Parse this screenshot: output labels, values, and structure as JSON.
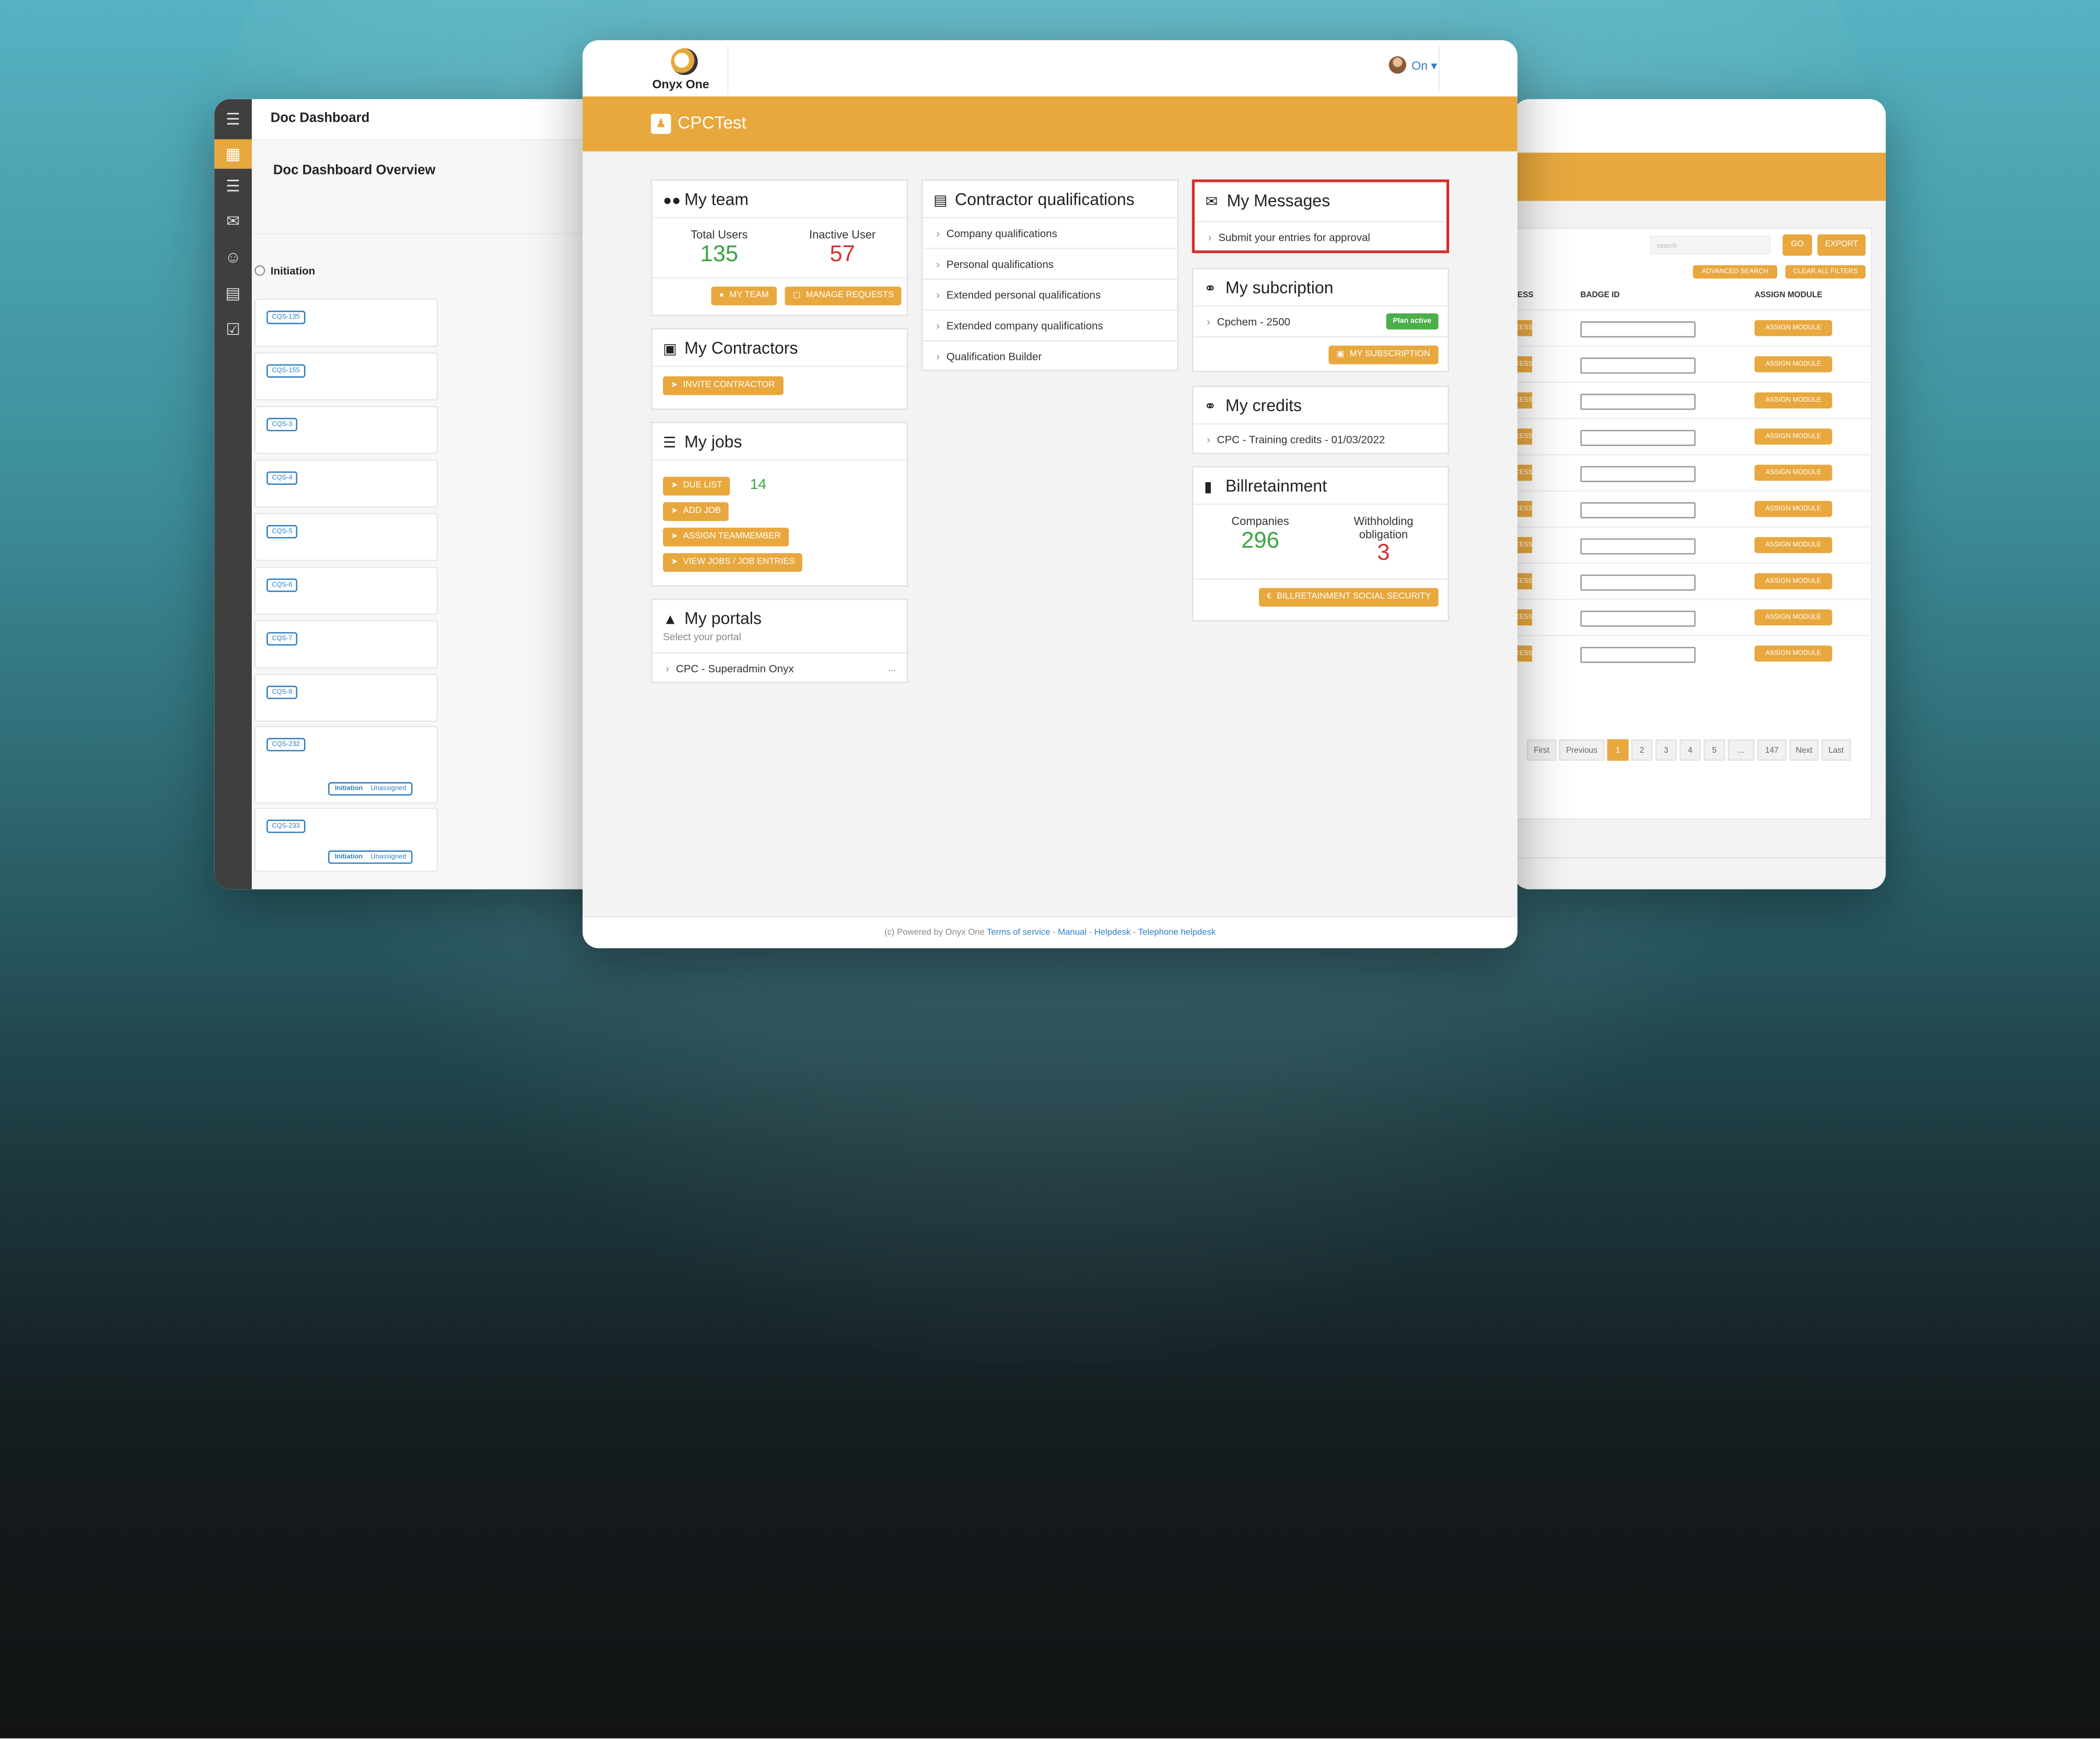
{
  "background_window_left": {
    "title": "Doc Dashboard",
    "overview": "Doc Dashboard Overview",
    "stage": "Initiation",
    "cards": [
      {
        "tag": "CQS-135"
      },
      {
        "tag": "CQS-155"
      },
      {
        "tag": "CQS-3"
      },
      {
        "tag": "CQS-4"
      },
      {
        "tag": "CQS-5"
      },
      {
        "tag": "CQS-6"
      },
      {
        "tag": "CQS-7"
      },
      {
        "tag": "CQS-8"
      },
      {
        "tag": "CQS-232",
        "pill_stage": "Initiation",
        "pill_status": "Unassigned"
      },
      {
        "tag": "CQS-233",
        "pill_stage": "Initiation",
        "pill_status": "Unassigned"
      }
    ],
    "rail_icons": [
      "menu-icon",
      "dashboard-icon",
      "list-icon",
      "inbox-icon",
      "user-icon",
      "building-icon",
      "checklist-icon"
    ]
  },
  "background_window_right": {
    "search_placeholder": "search",
    "go_label": "GO",
    "export_label": "EXPORT",
    "advanced_search_label": "ADVANCED SEARCH",
    "clear_filters_label": "CLEAR ALL FILTERS",
    "col_access": "ESS",
    "col_badge": "BADGE ID",
    "col_assign": "ASSIGN MODULE",
    "row_access_label": "ACCESS",
    "row_assign_label": "ASSIGN MODULE",
    "row_count": 10,
    "pager": [
      "First",
      "Previous",
      "1",
      "2",
      "3",
      "4",
      "5",
      "...",
      "147",
      "Next",
      "Last"
    ],
    "pager_current": "1"
  },
  "header": {
    "logo_text": "Onyx One",
    "user_label": "On ▾",
    "portal_title": "CPCTest"
  },
  "my_team": {
    "title": "My team",
    "total_label": "Total Users",
    "total_value": "135",
    "inactive_label": "Inactive User",
    "inactive_value": "57",
    "btn_team": "MY TEAM",
    "btn_requests": "MANAGE REQUESTS"
  },
  "my_contractors": {
    "title": "My Contractors",
    "btn_invite": "INVITE CONTRACTOR"
  },
  "my_jobs": {
    "title": "My jobs",
    "btn_due": "DUE LIST",
    "due_count": "14",
    "btn_add": "ADD JOB",
    "btn_assign": "ASSIGN TEAMMEMBER",
    "btn_view": "VIEW JOBS / JOB ENTRIES"
  },
  "my_portals": {
    "title": "My portals",
    "subtitle": "Select your portal",
    "item": "CPC - Superadmin Onyx",
    "item_more": "..."
  },
  "contractor_qualifications": {
    "title": "Contractor qualifications",
    "items": [
      "Company qualifications",
      "Personal qualifications",
      "Extended personal qualifications",
      "Extended company qualifications",
      "Qualification Builder"
    ]
  },
  "my_messages": {
    "title": "My Messages",
    "item": "Submit your entries for approval",
    "highlight_color": "#d62b2b"
  },
  "my_subscription": {
    "title": "My subcription",
    "item": "Cpchem - 2500",
    "status": "Plan active",
    "btn": "MY SUBSCRIPTION"
  },
  "my_credits": {
    "title": "My credits",
    "item": "CPC  -  Training credits  -  01/03/2022"
  },
  "billretainment": {
    "title": "Billretainment",
    "companies_label": "Companies",
    "companies_value": "296",
    "withholding_label": "Withholding obligation",
    "withholding_value": "3",
    "btn": "BILLRETAINMENT SOCIAL SECURITY"
  },
  "footer": {
    "powered": "(c) Powered by Onyx One",
    "terms": "Terms of service",
    "manual": "Manual",
    "helpdesk": "Helpdesk",
    "phone": "Telephone helpdesk",
    "dash": " - "
  },
  "colors": {
    "accent": "#e8a83e",
    "link": "#2f7fc1",
    "positive": "#3aa542",
    "negative": "#d0342c"
  }
}
